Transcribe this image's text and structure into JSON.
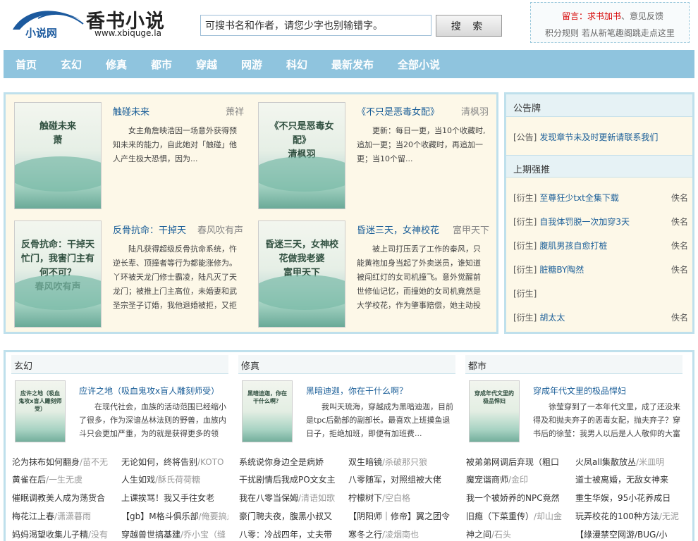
{
  "header": {
    "logo_sub": "小说网",
    "site_name": "香书小说",
    "site_url": "www.xbiquge.la",
    "search_placeholder": "可搜书名和作者，请您少字也别输错字。",
    "search_button": "搜 索",
    "notice_line1_prefix": "留言：",
    "notice_line1_red": "求书加书",
    "notice_line1_suffix": "、意见反馈",
    "notice_line2": "积分规则  若从新笔趣阁跳走点这里"
  },
  "nav": [
    "首页",
    "玄幻",
    "修真",
    "都市",
    "穿越",
    "网游",
    "科幻",
    "最新发布",
    "全部小说"
  ],
  "hot_books": [
    {
      "title": "触碰未来",
      "author": "萧祥",
      "cover_text": "触碰未来\n萧",
      "intro": "女主角詹映浩因一场意外获得预知未来的能力，自此她对「触碰」他人产生极大恐惧，因为..."
    },
    {
      "title": "《不只是恶毒女配》",
      "author": "清枫羽",
      "cover_text": "《不只是恶毒女配》\n清枫羽",
      "intro": "更新：每日一更，当10个收藏时,追加一更；当20个收藏时，再追加一更；当10个留..."
    },
    {
      "title": "反骨抗命：干掉天",
      "author": "春风吹有声",
      "cover_text": "反骨抗命：干掉天忙门，我害门主有何不可？\n春风吹有声",
      "intro": "陆凡获得超级反骨抗命系统，忤逆长辈、顶撞者等行为都能涨修为。丫环被天龙门修士霸凌，陆凡灭了天龙门；被推上门主高位，未婚妻和武圣宗圣子订婚，我他退婚被拒，又拒绝天机阁圣女的婚"
    },
    {
      "title": "昏迷三天，女神校花",
      "author": "富甲天下",
      "cover_text": "昏迷三天，女神校花做我老婆\n富甲天下",
      "intro": "被上司打压丢了工作的秦风，只能黄袍加身当起了外卖送员，谁知道被闯红灯的女司机撞飞。意外觉醒前世修仙记忆，而撞她的女司机竟然是大学校花，作为肇事赔偿，她主动投入秦风的怀抱，以身"
    }
  ],
  "side": {
    "notice_title": "公告牌",
    "notice_tag": "[公告]",
    "notice_text": "发现章节未及时更新请联系我们",
    "rank_title": "上期强推",
    "rank": [
      {
        "tag": "[衍生]",
        "title": "至尊狂少txt全集下载",
        "author": "佚名"
      },
      {
        "tag": "[衍生]",
        "title": "自我体罚脱一次加穿3天",
        "author": "佚名"
      },
      {
        "tag": "[衍生]",
        "title": "腹肌男孩自愈打桩",
        "author": "佚名"
      },
      {
        "tag": "[衍生]",
        "title": "脏糖BY陶然",
        "author": "佚名"
      },
      {
        "tag": "[衍生]",
        "title": "",
        "author": ""
      },
      {
        "tag": "[衍生]",
        "title": "胡太太",
        "author": "佚名"
      }
    ]
  },
  "categories": [
    {
      "name": "玄幻",
      "feature_title": "应许之地（吸血鬼攻x盲人雕刻师受）",
      "cover_text": "应许之地（吸血鬼攻x盲人雕刻师受）",
      "feature_intro": "在现代社会，血族的活动范围已经缩小了很多，作为深谙丛林法则的野兽，血族内斗只会更加严重，为的就是获得更多的领",
      "items": [
        {
          "title": "沦为抹布如何翻身",
          "author": "/苗不无"
        },
        {
          "title": "无论如何，终将告别",
          "author": "/KOTO"
        },
        {
          "title": "黄雀在后",
          "author": "/一生无虞"
        },
        {
          "title": "人生如戏",
          "author": "/酥氏荷荷糖"
        },
        {
          "title": "催眠调教美人成为荡货合",
          "author": ""
        },
        {
          "title": "上课挨骂！我又手往女老",
          "author": ""
        },
        {
          "title": "梅花江上春",
          "author": "/潇潇暮雨"
        },
        {
          "title": "【gb】M格斗俱乐部",
          "author": "/俺要搞点"
        },
        {
          "title": "妈妈渴望收集儿子精",
          "author": "/没有"
        },
        {
          "title": "穿越兽世搞基建",
          "author": "/乔小宝（缝"
        }
      ]
    },
    {
      "name": "修真",
      "feature_title": "黑暗迪迦，你在干什么啊？",
      "cover_text": "黑暗迪迦，你在干什么啊？",
      "feature_intro": "我叫天琉海，穿越成为黑暗迪迦，目前是tpc后勤部的副部长。最喜欢上班摸鱼退日子，拒绝加班，即便有加班费...",
      "items": [
        {
          "title": "系统说你身边全是病娇",
          "author": ""
        },
        {
          "title": "双生暗镜",
          "author": "/杀破那只狼"
        },
        {
          "title": "干扰剧情后我成PO文女主",
          "author": ""
        },
        {
          "title": "八零随军，对照组被大佬",
          "author": ""
        },
        {
          "title": "我在八零当保姆",
          "author": "/清语如歌"
        },
        {
          "title": "柠檬树下",
          "author": "/空白格"
        },
        {
          "title": "豪门聘夫夜，腹黑小叔又",
          "author": ""
        },
        {
          "title": "【阴阳师｜修帝】翼之团令",
          "author": ""
        },
        {
          "title": "八零：冷战四年，丈夫带",
          "author": ""
        },
        {
          "title": "寒冬之行",
          "author": "/凌烟南也"
        }
      ]
    },
    {
      "name": "都市",
      "feature_title": "穿成年代文里的极品悍妇",
      "cover_text": "穿成年代文里的极品悍妇",
      "feature_intro": "徐莹穿到了一本年代文里，成了还没来得及和抛夫弃子的恶毒女配，抛夫弃子？穿书后的徐莹：我男人以后是人人敬仰的大富",
      "items": [
        {
          "title": "被弟弟网调后弃现（粗口",
          "author": ""
        },
        {
          "title": "火凤all集散放丛",
          "author": "/米皿明"
        },
        {
          "title": "魔宠谐商师",
          "author": "/金印"
        },
        {
          "title": "道士被离婚，无敌女神来",
          "author": ""
        },
        {
          "title": "我一个被娇养的NPC竟然",
          "author": ""
        },
        {
          "title": "重生华娱，95小花养成日",
          "author": ""
        },
        {
          "title": "旧瘾（下菜重传）",
          "author": "/却山金"
        },
        {
          "title": "玩弄校花的100种方法",
          "author": "/无泥"
        },
        {
          "title": "神之间",
          "author": "/石头"
        },
        {
          "title": "【綠漫禁空网游/BUG/小",
          "author": ""
        }
      ]
    }
  ]
}
